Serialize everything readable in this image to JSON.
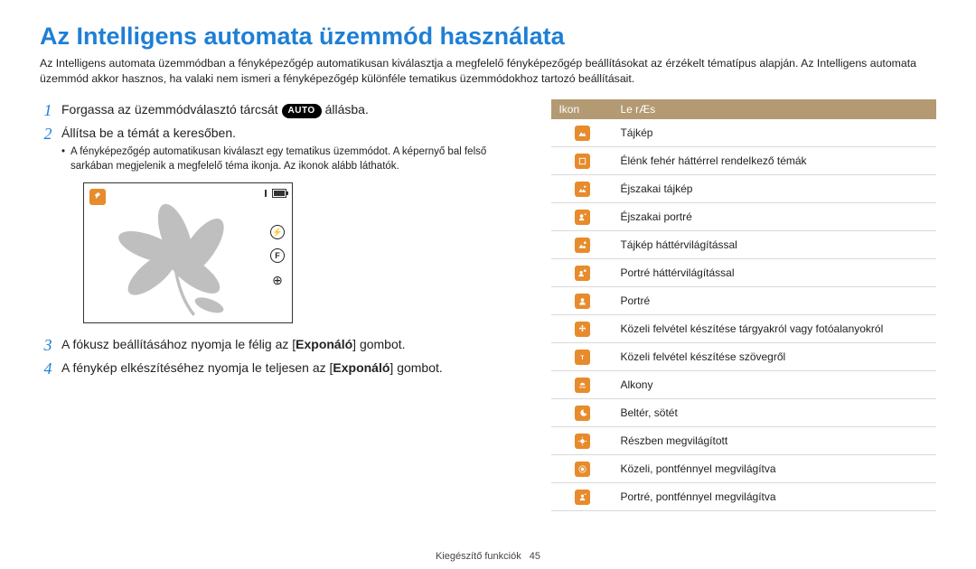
{
  "title": "Az Intelligens automata üzemmód használata",
  "intro": "Az Intelligens automata üzemmódban a fényképezőgép automatikusan kiválasztja a megfelelő fényképezőgép beállításokat az érzékelt tématípus alapján. Az Intelligens automata üzemmód akkor hasznos, ha valaki nem ismeri a fényképezőgép különféle tematikus üzemmódokhoz tartozó beállításait.",
  "steps": {
    "s1a": "Forgassa az üzemmódválasztó tárcsát ",
    "s1_auto": "AUTO",
    "s1b": " állásba.",
    "s2": "Állítsa be a témát a keresőben.",
    "s2_sub": "A fényképezőgép automatikusan kiválaszt egy tematikus üzemmódot. A képernyő bal felső sarkában megjelenik a megfelelő téma ikonja. Az ikonok alább láthatók.",
    "s3": "Exponáló",
    "s3_full_a": "A fókusz beállításához nyomja le félig az [",
    "s3_full_b": "] gombot.",
    "s4": "Exponáló",
    "s4_full_a": "A fénykép elkészítéséhez nyomja le teljesen az [",
    "s4_full_b": "] gombot."
  },
  "table": {
    "header_icon": "Ikon",
    "header_desc": "Le rÆs",
    "rows": [
      {
        "icon": "mountain",
        "text": "Tájkép"
      },
      {
        "icon": "square",
        "text": "Élénk fehér háttérrel rendelkező témák"
      },
      {
        "icon": "night-mtn",
        "text": "Éjszakai tájkép"
      },
      {
        "icon": "night-port",
        "text": "Éjszakai portré"
      },
      {
        "icon": "mtn-sun",
        "text": "Tájkép háttérvilágítással"
      },
      {
        "icon": "port-sun",
        "text": "Portré háttérvilágítással"
      },
      {
        "icon": "face",
        "text": "Portré"
      },
      {
        "icon": "flower",
        "text": "Közeli felvétel készítése tárgyakról vagy fotóalanyokról"
      },
      {
        "icon": "text",
        "text": "Közeli felvétel készítése szövegről"
      },
      {
        "icon": "sunset",
        "text": "Alkony"
      },
      {
        "icon": "night-in",
        "text": "Beltér, sötét"
      },
      {
        "icon": "spotlight",
        "text": "Részben megvilágított"
      },
      {
        "icon": "close-spot",
        "text": "Közeli, pontfénnyel megvilágítva"
      },
      {
        "icon": "port-spot",
        "text": "Portré, pontfénnyel megvilágítva"
      }
    ]
  },
  "footer": {
    "section": "Kiegészítő funkciók",
    "page": "45"
  },
  "colors": {
    "accent": "#1e7fd6",
    "icon_orange": "#e78b2c",
    "table_header": "#b39a72"
  }
}
